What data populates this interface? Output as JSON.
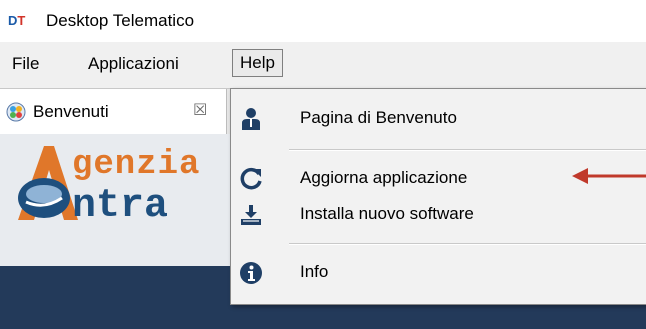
{
  "window": {
    "logo_text_d": "D",
    "logo_text_t": "T",
    "title": "Desktop Telematico"
  },
  "menubar": {
    "items": [
      {
        "label": "File"
      },
      {
        "label": "Applicazioni"
      },
      {
        "label": "Help"
      }
    ]
  },
  "tabs": [
    {
      "label": "Benvenuti",
      "close_glyph": "☒",
      "active": true
    }
  ],
  "banner": {
    "line1": "genzia",
    "line2": "ntra"
  },
  "help_menu": {
    "items": [
      {
        "label": "Pagina di Benvenuto",
        "icon": "person-icon"
      },
      {
        "label": "Aggiorna  applicazione",
        "icon": "refresh-icon",
        "highlighted_by_arrow": true
      },
      {
        "label": "Installa nuovo software",
        "icon": "install-icon"
      },
      {
        "label": "Info",
        "icon": "info-icon"
      }
    ]
  },
  "colors": {
    "accent_arrow": "#c0392b",
    "banner_dark": "#233a5a",
    "logo_orange": "#e0772a",
    "logo_blue": "#1e4f7e"
  }
}
